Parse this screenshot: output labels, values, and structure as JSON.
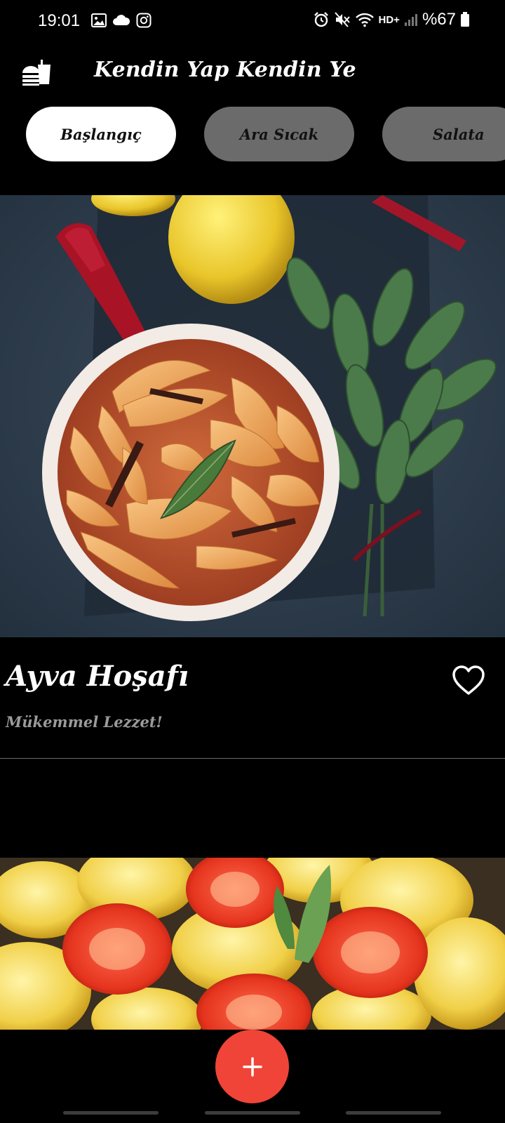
{
  "status_bar": {
    "time": "19:01",
    "network": "HD+",
    "battery": "%67",
    "icons": [
      "gallery-icon",
      "cloud-icon",
      "instagram-icon",
      "alarm-icon",
      "mute-icon",
      "wifi-icon",
      "signal-icon",
      "battery-icon"
    ]
  },
  "app_bar": {
    "title": "Kendin Yap Kendin Ye",
    "menu_icon": "fastfood-icon"
  },
  "categories": [
    {
      "label": "Başlangıç",
      "active": true
    },
    {
      "label": "Ara Sıcak",
      "active": false
    },
    {
      "label": "Salata",
      "active": false
    }
  ],
  "recipes": [
    {
      "title": "Ayva Hoşafı",
      "subtitle": "Mükemmel Lezzet!",
      "favorite_icon": "heart-outline-icon"
    }
  ],
  "fab": {
    "icon": "plus-icon"
  },
  "colors": {
    "background": "#000000",
    "chip_active": "#ffffff",
    "chip_inactive": "#6b6b6b",
    "fab": "#f04438",
    "subtitle": "#9a9a9a"
  }
}
